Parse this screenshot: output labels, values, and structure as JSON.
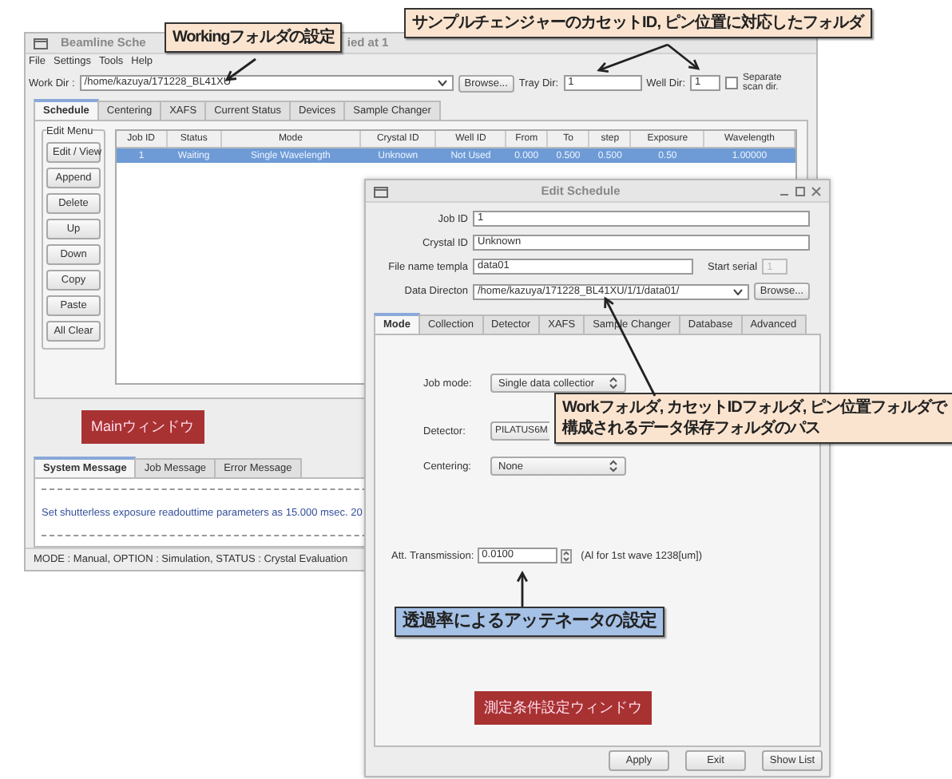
{
  "main_window": {
    "title_parts": [
      "Beamline Sche",
      "ied at 1"
    ],
    "menu": [
      "File",
      "Settings",
      "Tools",
      "Help"
    ],
    "work_dir": {
      "label": "Work Dir :",
      "value": "/home/kazuya/171228_BL41XU"
    },
    "browse": "Browse...",
    "tray_dir": {
      "label": "Tray Dir:",
      "value": "1"
    },
    "well_dir": {
      "label": "Well Dir:",
      "value": "1"
    },
    "separate_scan_dir": {
      "label": "Separate scan dir.",
      "checked": false
    },
    "tabs": [
      {
        "label": "Schedule",
        "selected": true
      },
      {
        "label": "Centering",
        "selected": false
      },
      {
        "label": "XAFS",
        "selected": false
      },
      {
        "label": "Current Status",
        "selected": false
      },
      {
        "label": "Devices",
        "selected": false
      },
      {
        "label": "Sample Changer",
        "selected": false
      }
    ],
    "edit_menu": {
      "title": "Edit Menu",
      "buttons": [
        "Edit / View",
        "Append",
        "Delete",
        "Up",
        "Down",
        "Copy",
        "Paste",
        "All Clear"
      ]
    },
    "table": {
      "columns": [
        "Job ID",
        "Status",
        "Mode",
        "Crystal ID",
        "Well ID",
        "From",
        "To",
        "step",
        "Exposure",
        "Wavelength"
      ],
      "rows": [
        {
          "cells": [
            "1",
            "Waiting",
            "Single Wavelength",
            "Unknown",
            "Not Used",
            "0.000",
            "0.500",
            "0.500",
            "0.50",
            "1.00000"
          ],
          "selected": true
        }
      ]
    },
    "label": "Mainウィンドウ",
    "message_tabs": [
      {
        "label": "System Message",
        "selected": true
      },
      {
        "label": "Job Message",
        "selected": false
      },
      {
        "label": "Error Message",
        "selected": false
      }
    ],
    "messages": [
      "Set shutterless exposure readouttime parameters as 15.000 msec. 20"
    ],
    "status_bar": "MODE : Manual,   OPTION : Simulation,   STATUS : Crystal Evaluation"
  },
  "edit_window": {
    "title": "Edit Schedule",
    "fields": [
      {
        "label": "Job ID",
        "value": "1"
      },
      {
        "label": "Crystal ID",
        "value": "Unknown"
      }
    ],
    "file_name": {
      "label": "File name templa",
      "value": "data01"
    },
    "start_serial": {
      "label": "Start serial",
      "value": "1",
      "disabled": true
    },
    "data_dir": {
      "label": "Data Directon",
      "value": "/home/kazuya/171228_BL41XU/1/1/data01/"
    },
    "browse": "Browse...",
    "tabs": [
      {
        "label": "Mode",
        "selected": true
      },
      {
        "label": "Collection",
        "selected": false
      },
      {
        "label": "Detector",
        "selected": false
      },
      {
        "label": "XAFS",
        "selected": false
      },
      {
        "label": "Sample Changer",
        "selected": false
      },
      {
        "label": "Database",
        "selected": false
      },
      {
        "label": "Advanced",
        "selected": false
      }
    ],
    "job_mode": {
      "label": "Job mode:",
      "value": "Single data collectior"
    },
    "detector": {
      "label": "Detector:",
      "value": "PILATUS6M"
    },
    "centering": {
      "label": "Centering:",
      "value": "None"
    },
    "att_transmission": {
      "label": "Att. Transmission:",
      "value": "0.0100",
      "note": "(Al for 1st wave 1238[um])"
    },
    "label": "測定条件設定ウィンドウ",
    "buttons": [
      "Apply",
      "Exit",
      "Show List"
    ]
  },
  "callouts": [
    {
      "kind": "peach",
      "lines": [
        "Workingフォルダの設定"
      ]
    },
    {
      "kind": "peach",
      "lines": [
        "サンプルチェンジャーのカセットID, ピン位置に対応したフォルダ"
      ]
    },
    {
      "kind": "peach",
      "lines": [
        "Workフォルダ, カセットIDフォルダ, ピン位置フォルダで",
        "構成されるデータ保存フォルダのパス"
      ]
    },
    {
      "kind": "blue",
      "lines": [
        "透過率によるアッテネータの設定"
      ]
    }
  ]
}
